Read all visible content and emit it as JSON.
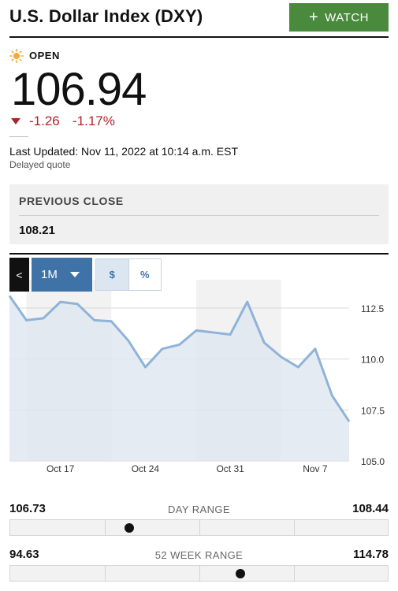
{
  "header": {
    "title": "U.S. Dollar Index (DXY)",
    "watch_label": "WATCH",
    "watch_plus": "+"
  },
  "quote": {
    "status": "OPEN",
    "price": "106.94",
    "change": "-1.26",
    "change_pct": "-1.17%",
    "last_updated": "Last Updated: Nov 11, 2022 at 10:14 a.m. EST",
    "delayed": "Delayed quote"
  },
  "previous_close": {
    "label": "PREVIOUS CLOSE",
    "value": "108.21"
  },
  "chart_controls": {
    "back_label": "<",
    "range_label": "1M",
    "unit_dollar": "$",
    "unit_percent": "%"
  },
  "chart_data": {
    "type": "area",
    "x": [
      "Oct 12",
      "Oct 13",
      "Oct 14",
      "Oct 17",
      "Oct 18",
      "Oct 19",
      "Oct 20",
      "Oct 21",
      "Oct 24",
      "Oct 25",
      "Oct 26",
      "Oct 27",
      "Oct 28",
      "Oct 31",
      "Nov 1",
      "Nov 2",
      "Nov 3",
      "Nov 4",
      "Nov 7",
      "Nov 8",
      "Nov 9",
      "Nov 10",
      "Nov 11"
    ],
    "values": [
      113.1,
      111.9,
      112.0,
      112.8,
      112.7,
      111.9,
      111.85,
      110.9,
      109.6,
      110.5,
      110.7,
      111.4,
      111.3,
      111.2,
      112.8,
      110.8,
      110.1,
      109.6,
      110.5,
      108.2,
      106.94
    ],
    "y_ticks": [
      "112.5",
      "110.0",
      "107.5",
      "105.0"
    ],
    "x_ticks": [
      "Oct 17",
      "Oct 24",
      "Oct 31",
      "Nov 7"
    ],
    "ylim": [
      105.0,
      113.5
    ],
    "colors": {
      "line": "#8fb3d9",
      "fill": "#dfe8f1",
      "band": "#f2f2f2",
      "grid": "#d8d8d8"
    }
  },
  "day_range": {
    "low": "106.73",
    "label": "DAY RANGE",
    "high": "108.44",
    "position": 0.31
  },
  "week52_range": {
    "low": "94.63",
    "label": "52 WEEK RANGE",
    "high": "114.78",
    "position": 0.61
  }
}
